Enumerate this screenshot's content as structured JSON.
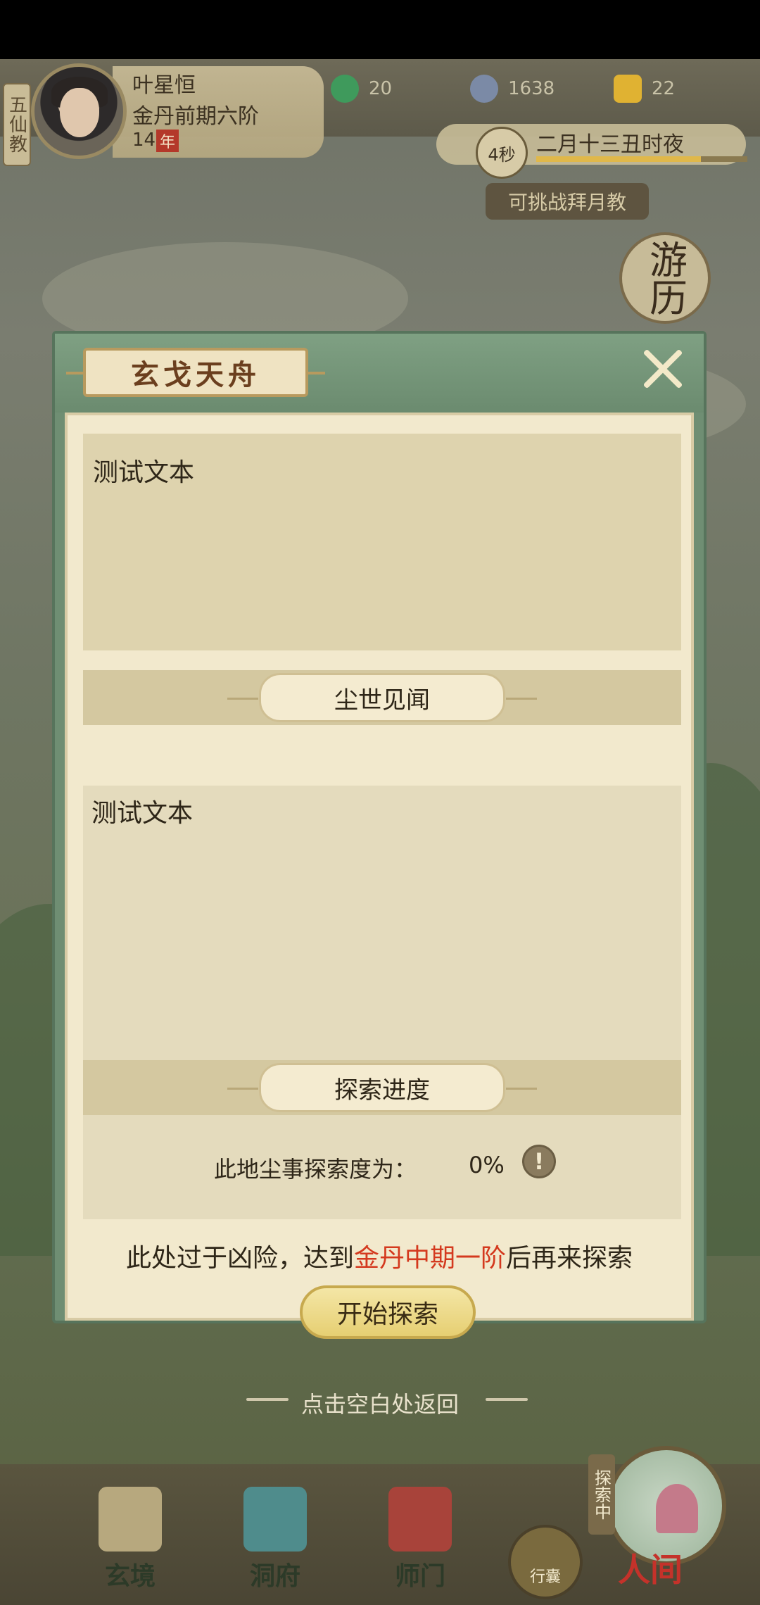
{
  "header": {
    "sect": "五仙教",
    "player_name": "叶星恒",
    "realm": "金丹前期六阶",
    "age_value": "14",
    "age_unit": "年",
    "resources": [
      {
        "icon": "jade-icon",
        "value": "20",
        "color": "#3f9a5c"
      },
      {
        "icon": "coin-icon",
        "value": "1638",
        "color": "#7b8aa6"
      },
      {
        "icon": "ingot-icon",
        "value": "22",
        "color": "#e0b232"
      }
    ],
    "time_left": "4秒",
    "date": "二月十三丑时夜",
    "time_progress": 0.78,
    "challenge_label": "可挑战拜月教",
    "travel_label": "游历"
  },
  "modal": {
    "title": "玄戈天舟",
    "description": "测试文本",
    "section_world": "尘世见闻",
    "world_text": "测试文本",
    "section_progress": "探索进度",
    "progress_label": "此地尘事探索度为：",
    "progress_value": "0%",
    "info_glyph": "!",
    "warning_prefix": "此处过于凶险，达到",
    "warning_highlight": "金丹中期一阶",
    "warning_suffix": "后再来探索",
    "start_button": "开始探索",
    "highlight_color": "#d4391e"
  },
  "return_hint": "点击空白处返回",
  "bottom_nav": {
    "items": [
      {
        "label": "玄境",
        "icon": "scroll-icon"
      },
      {
        "label": "洞府",
        "icon": "pavilion-icon"
      },
      {
        "label": "师门",
        "icon": "banner-icon"
      }
    ],
    "bag_label": "行囊",
    "exploring_tag": "探索中",
    "world_label": "人间"
  }
}
